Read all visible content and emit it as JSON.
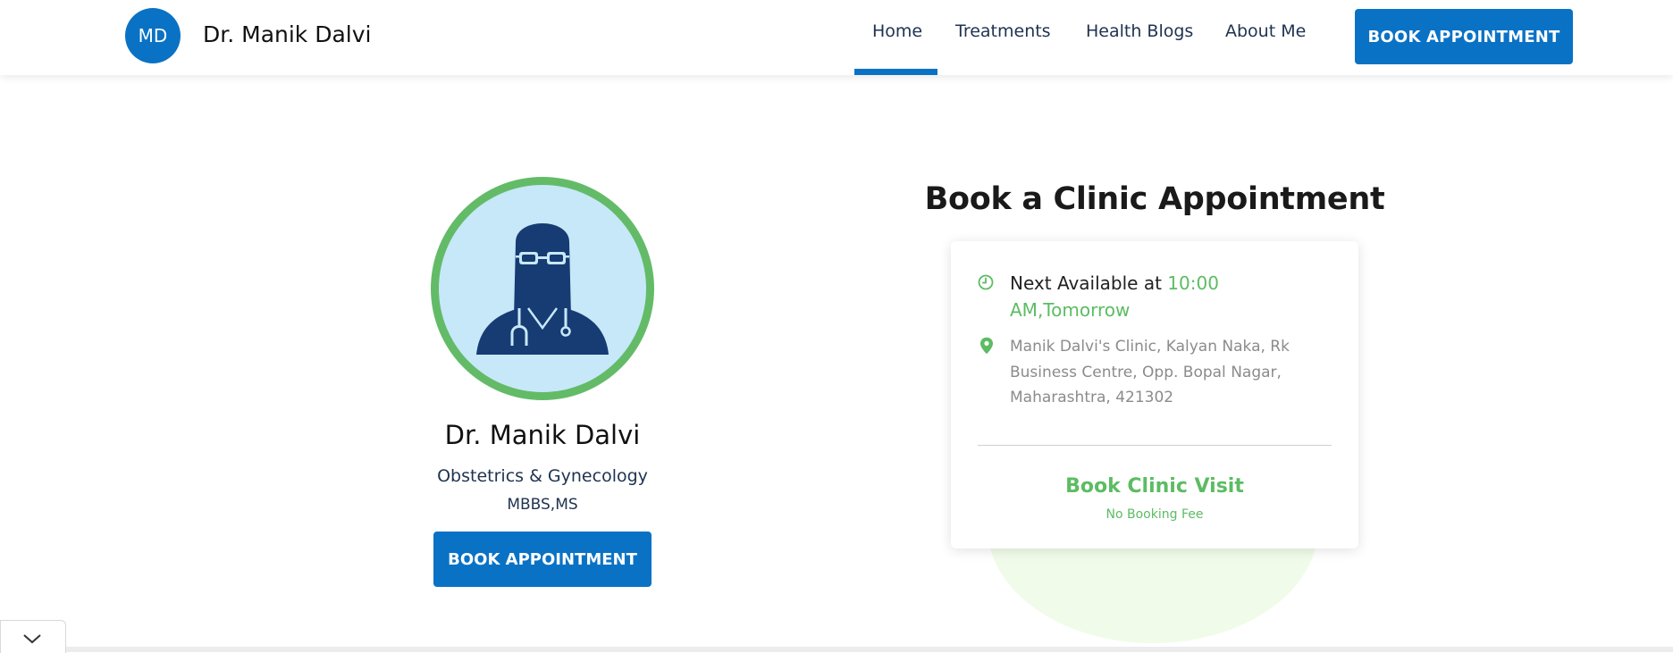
{
  "header": {
    "logo_initials": "MD",
    "brand_name": "Dr. Manik Dalvi",
    "nav": [
      "Home",
      "Treatments",
      "Health Blogs",
      "About Me"
    ],
    "active_nav": "Home",
    "cta_label": "BOOK APPOINTMENT"
  },
  "profile": {
    "name": "Dr. Manik Dalvi",
    "specialty": "Obstetrics & Gynecology",
    "degree": "MBBS,MS",
    "cta_label": "BOOK APPOINTMENT",
    "avatar_icon": "doctor-avatar-icon"
  },
  "booking": {
    "title": "Book a Clinic Appointment",
    "next_available_label": "Next Available at ",
    "next_available_time": "10:00 AM,Tomorrow",
    "address": "Manik Dalvi's Clinic, Kalyan Naka, Rk Business Centre, Opp. Bopal Nagar, Maharashtra, 421302",
    "visit_label": "Book Clinic Visit",
    "fee_note": "No Booking Fee"
  },
  "colors": {
    "primary": "#0a72c5",
    "accent_green": "#5cbc63",
    "avatar_ring": "#63bb68",
    "avatar_bg": "#c7e8f8"
  }
}
